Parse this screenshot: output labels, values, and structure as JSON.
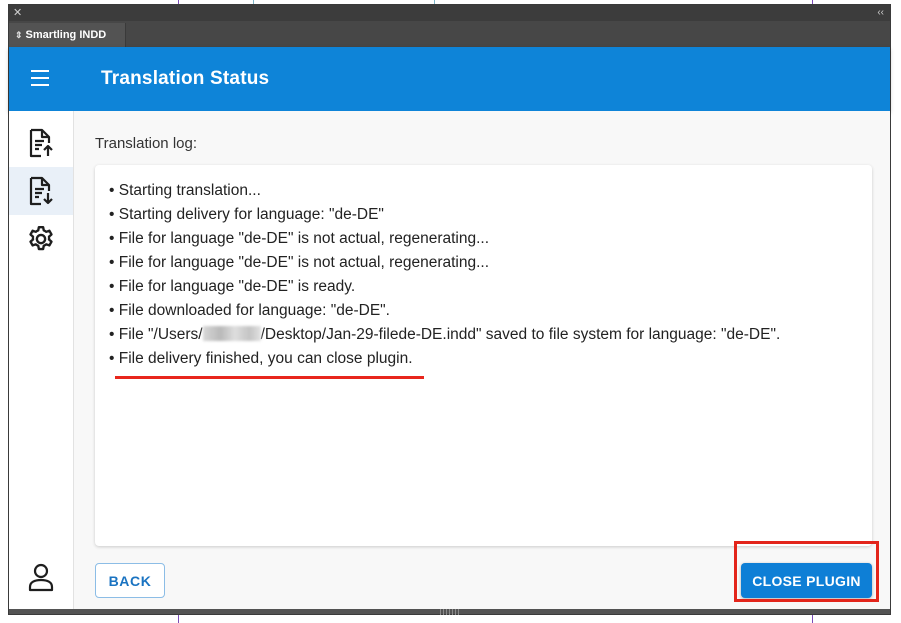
{
  "window": {
    "close_glyph": "✕",
    "collapse_glyph": "‹‹",
    "tab_label": "Smartling INDD",
    "tab_updown_glyph": "⇕"
  },
  "appbar": {
    "title": "Translation Status",
    "color": "#0e84d8"
  },
  "sidenav": {
    "items": [
      {
        "icon": "file-upload-icon",
        "active": false
      },
      {
        "icon": "file-download-icon",
        "active": true
      },
      {
        "icon": "gear-icon",
        "active": false
      },
      {
        "icon": "user-icon",
        "active": false
      }
    ]
  },
  "main": {
    "log_label": "Translation log:",
    "log_lines": [
      "• Starting translation...",
      "• Starting delivery for language: \"de-DE\"",
      "• File for language \"de-DE\" is not actual, regenerating...",
      "• File for language \"de-DE\" is not actual, regenerating...",
      "• File for language \"de-DE\" is ready.",
      "• File downloaded for language: \"de-DE\"."
    ],
    "saved_line_prefix": "• File \"/Users/",
    "saved_line_suffix": "/Desktop/Jan-29-filede-DE.indd\" saved to file system for language: \"de-DE\".",
    "final_line": "• File delivery finished, you can close plugin."
  },
  "buttons": {
    "back_label": "BACK",
    "close_label": "CLOSE PLUGIN"
  },
  "colors": {
    "accent": "#0e84d8",
    "annotation": "#e3251b"
  }
}
